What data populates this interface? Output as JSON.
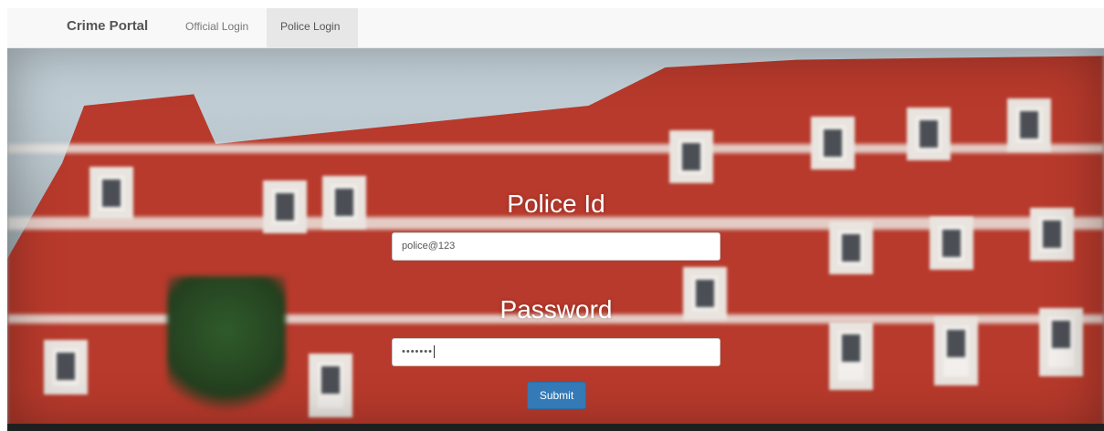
{
  "navbar": {
    "brand": "Crime Portal",
    "links": [
      {
        "label": "Official Login",
        "active": false
      },
      {
        "label": "Police Login",
        "active": true
      }
    ]
  },
  "form": {
    "police_id_label": "Police Id",
    "police_id_value": "police@123",
    "password_label": "Password",
    "password_value_masked": "•••••••",
    "submit_label": "Submit"
  },
  "colors": {
    "accent": "#337ab7",
    "navbar_bg": "#f8f8f8",
    "active_tab_bg": "#e7e7e7"
  }
}
